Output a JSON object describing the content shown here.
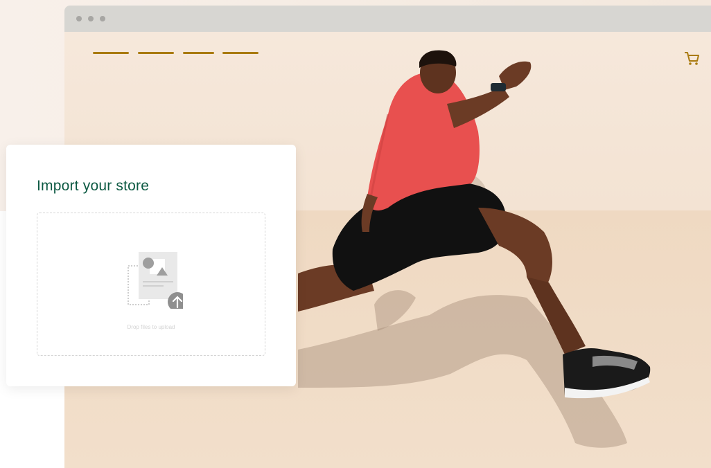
{
  "colors": {
    "accent": "#a97a10",
    "title": "#0d5a43",
    "titlebar": "#d7d6d2",
    "shirt": "#e8504f",
    "shorts": "#111111"
  },
  "browser": {
    "window_controls": [
      "dot",
      "dot",
      "dot"
    ],
    "nav_lines": 4,
    "cart_icon": "cart-icon"
  },
  "import_card": {
    "title": "Import your store",
    "dropzone_hint": "Drop files to upload",
    "icon": "file-upload-icon"
  },
  "hero": {
    "image": "athlete-jumping-photo"
  }
}
